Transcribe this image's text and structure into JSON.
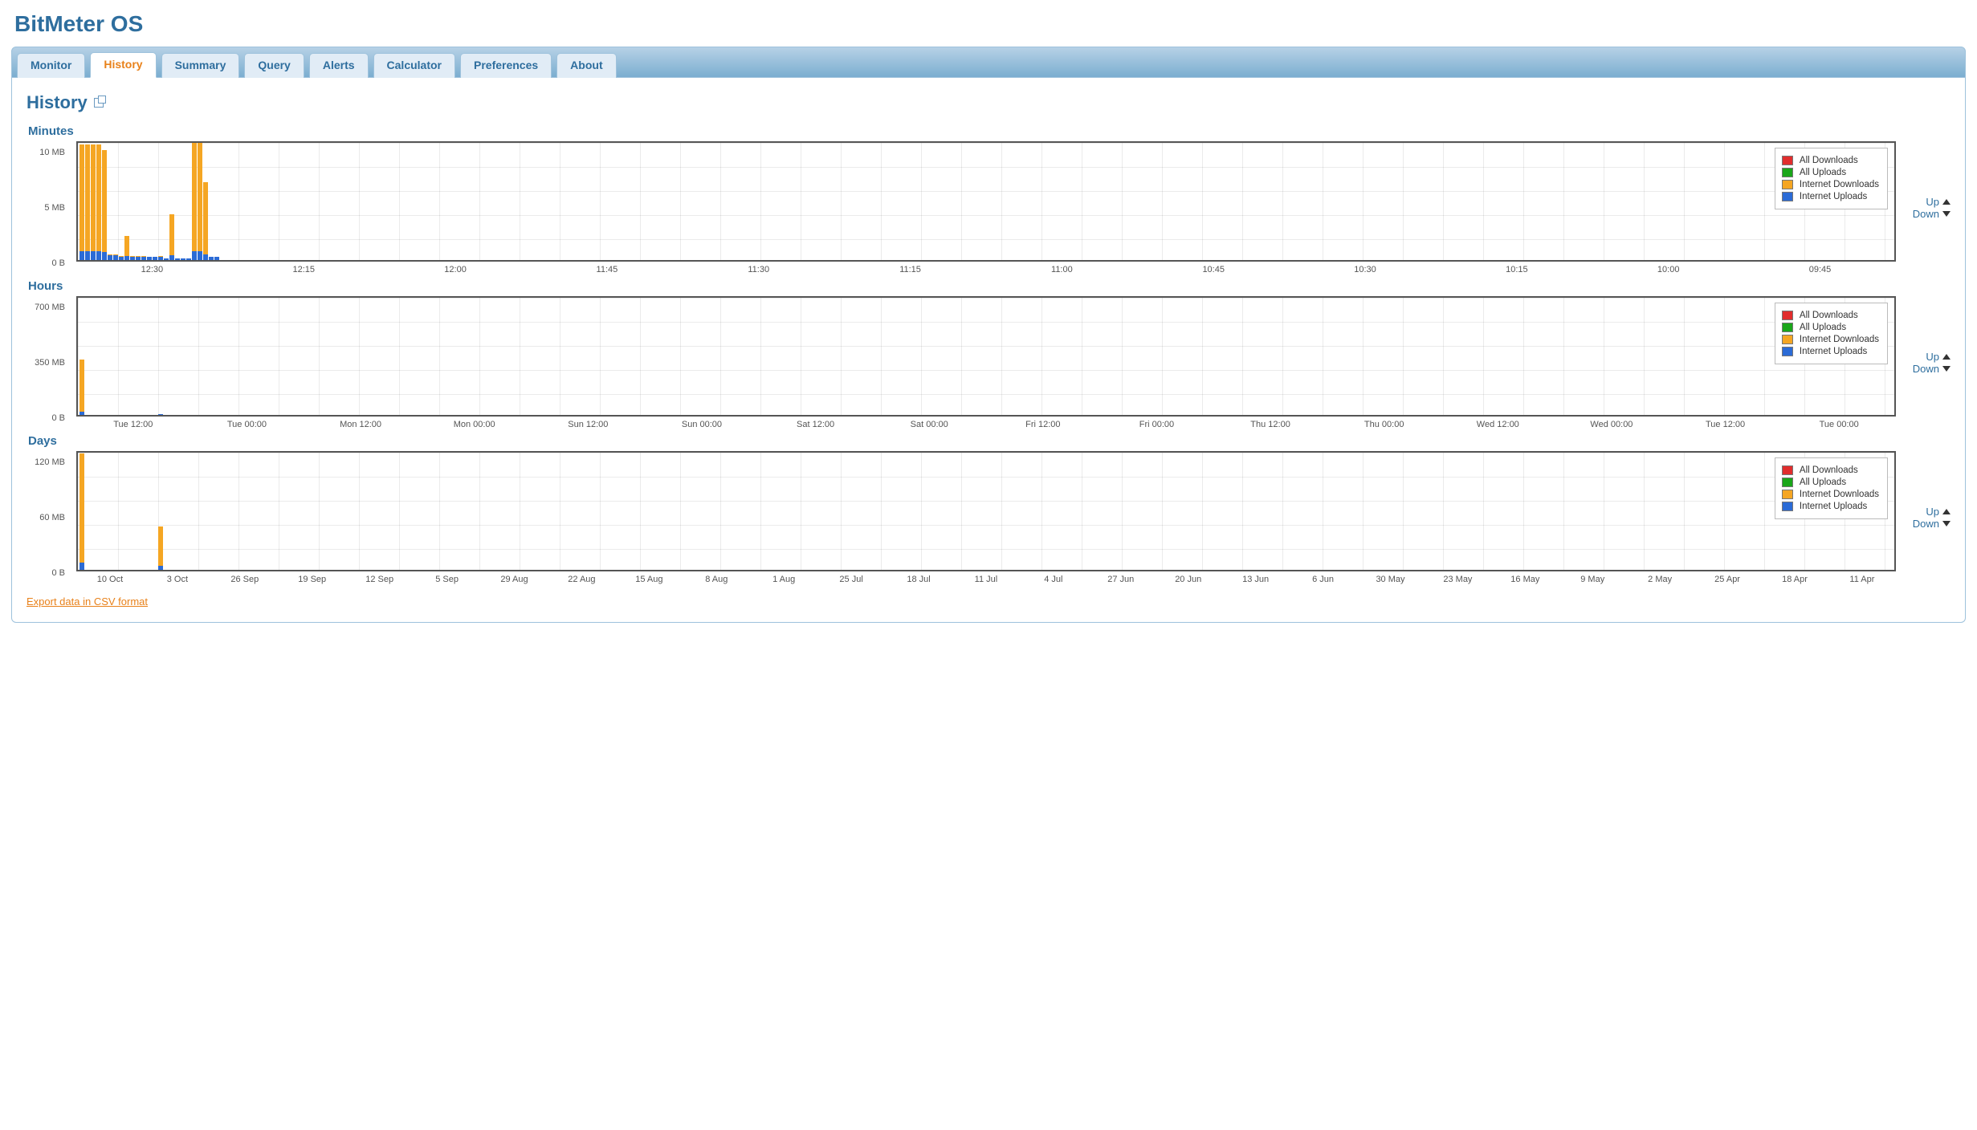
{
  "app_title": "BitMeter OS",
  "tabs": [
    {
      "id": "monitor",
      "label": "Monitor"
    },
    {
      "id": "history",
      "label": "History"
    },
    {
      "id": "summary",
      "label": "Summary"
    },
    {
      "id": "query",
      "label": "Query"
    },
    {
      "id": "alerts",
      "label": "Alerts"
    },
    {
      "id": "calculator",
      "label": "Calculator"
    },
    {
      "id": "preferences",
      "label": "Preferences"
    },
    {
      "id": "about",
      "label": "About"
    }
  ],
  "active_tab": "history",
  "page_title": "History",
  "nav": {
    "up": "Up",
    "down": "Down"
  },
  "legend": [
    {
      "label": "All Downloads",
      "color": "#e12d2d"
    },
    {
      "label": "All Uploads",
      "color": "#1aa61a"
    },
    {
      "label": "Internet Downloads",
      "color": "#f5a623"
    },
    {
      "label": "Internet Uploads",
      "color": "#2b6bd6"
    }
  ],
  "export_label": "Export data in CSV format",
  "sections": {
    "minutes": {
      "title": "Minutes"
    },
    "hours": {
      "title": "Hours"
    },
    "days": {
      "title": "Days"
    }
  },
  "chart_data": [
    {
      "id": "minutes",
      "type": "bar",
      "title": "Minutes",
      "ylabel": "",
      "y_ticks": [
        "10 MB",
        "5 MB",
        "0 B"
      ],
      "ylim_mb": [
        0,
        12
      ],
      "x_ticks": [
        "12:30",
        "12:15",
        "12:00",
        "11:45",
        "11:30",
        "11:15",
        "11:00",
        "10:45",
        "10:30",
        "10:15",
        "10:00",
        "09:45"
      ],
      "series": [
        {
          "name": "Internet Downloads",
          "unit": "MB",
          "values": [
            11.5,
            11.5,
            11.5,
            11.5,
            11.0,
            0.6,
            0.6,
            0.4,
            2.4,
            0.4,
            0.4,
            0.4,
            0.3,
            0.3,
            0.4,
            0.2,
            4.6,
            0.2,
            0.2,
            0.2,
            11.8,
            11.8,
            7.8,
            0.3,
            0.3
          ]
        },
        {
          "name": "Internet Uploads",
          "unit": "MB",
          "values": [
            0.9,
            0.9,
            0.9,
            0.9,
            0.8,
            0.5,
            0.5,
            0.3,
            0.4,
            0.3,
            0.3,
            0.3,
            0.3,
            0.3,
            0.3,
            0.2,
            0.5,
            0.2,
            0.2,
            0.2,
            0.9,
            0.9,
            0.6,
            0.3,
            0.3
          ]
        },
        {
          "name": "All Downloads",
          "unit": "MB",
          "values": [
            0,
            0,
            0,
            0,
            0,
            0,
            0,
            0,
            0,
            0,
            0,
            0,
            0,
            0,
            0,
            0,
            0,
            0,
            0,
            0,
            0,
            0,
            0,
            0,
            0
          ]
        },
        {
          "name": "All Uploads",
          "unit": "MB",
          "values": [
            0,
            0,
            0,
            0,
            0,
            0,
            0,
            0,
            0,
            0,
            0,
            0,
            0,
            0,
            0,
            0,
            0,
            0,
            0,
            0,
            0,
            0,
            0,
            0,
            0
          ]
        }
      ]
    },
    {
      "id": "hours",
      "type": "bar",
      "title": "Hours",
      "ylabel": "",
      "y_ticks": [
        "700 MB",
        "350 MB",
        "0 B"
      ],
      "ylim_mb": [
        0,
        700
      ],
      "x_ticks": [
        "Tue 12:00",
        "Tue 00:00",
        "Mon 12:00",
        "Mon 00:00",
        "Sun 12:00",
        "Sun 00:00",
        "Sat 12:00",
        "Sat 00:00",
        "Fri 12:00",
        "Fri 00:00",
        "Thu 12:00",
        "Thu 00:00",
        "Wed 12:00",
        "Wed 00:00",
        "Tue 12:00",
        "Tue 00:00"
      ],
      "series": [
        {
          "name": "Internet Downloads",
          "unit": "MB",
          "values": [
            320,
            0,
            0,
            0,
            0,
            0,
            0,
            0,
            0,
            0,
            0,
            0,
            0,
            0,
            6,
            0,
            0,
            0,
            0,
            0,
            0,
            0,
            0,
            0,
            0,
            0,
            0,
            0,
            0,
            0,
            0,
            0,
            0,
            0
          ]
        },
        {
          "name": "Internet Uploads",
          "unit": "MB",
          "values": [
            18,
            0,
            0,
            0,
            0,
            0,
            0,
            0,
            0,
            0,
            0,
            0,
            0,
            0,
            3,
            0,
            0,
            0,
            0,
            0,
            0,
            0,
            0,
            0,
            0,
            0,
            0,
            0,
            0,
            0,
            0,
            0,
            0,
            0
          ]
        },
        {
          "name": "All Downloads",
          "unit": "MB",
          "values": [
            0,
            0,
            0,
            0,
            0,
            0,
            0,
            0,
            0,
            0,
            0,
            0,
            0,
            0,
            0,
            0,
            0,
            0,
            0,
            0,
            0,
            0,
            0,
            0,
            0,
            0,
            0,
            0,
            0,
            0,
            0,
            0,
            0,
            0
          ]
        },
        {
          "name": "All Uploads",
          "unit": "MB",
          "values": [
            0,
            0,
            0,
            0,
            0,
            0,
            0,
            0,
            0,
            0,
            0,
            0,
            0,
            0,
            0,
            0,
            0,
            0,
            0,
            0,
            0,
            0,
            0,
            0,
            0,
            0,
            0,
            0,
            0,
            0,
            0,
            0,
            0,
            0
          ]
        }
      ]
    },
    {
      "id": "days",
      "type": "bar",
      "title": "Days",
      "ylabel": "",
      "y_ticks": [
        "120 MB",
        "60 MB",
        "0 B"
      ],
      "ylim_mb": [
        0,
        160
      ],
      "x_ticks": [
        "10 Oct",
        "3 Oct",
        "26 Sep",
        "19 Sep",
        "12 Sep",
        "5 Sep",
        "29 Aug",
        "22 Aug",
        "15 Aug",
        "8 Aug",
        "1 Aug",
        "25 Jul",
        "18 Jul",
        "11 Jul",
        "4 Jul",
        "27 Jun",
        "20 Jun",
        "13 Jun",
        "6 Jun",
        "30 May",
        "23 May",
        "16 May",
        "9 May",
        "2 May",
        "25 Apr",
        "18 Apr",
        "11 Apr"
      ],
      "series": [
        {
          "name": "Internet Downloads",
          "unit": "MB",
          "values": [
            155,
            0,
            0,
            0,
            0,
            0,
            0,
            0,
            0,
            0,
            0,
            0,
            0,
            0,
            58,
            0,
            0,
            0,
            0,
            0,
            0,
            0,
            0,
            0,
            0,
            0,
            0,
            0,
            0,
            0,
            0,
            0,
            0,
            0,
            0,
            0,
            0,
            0,
            0,
            0
          ]
        },
        {
          "name": "Internet Uploads",
          "unit": "MB",
          "values": [
            10,
            0,
            0,
            0,
            0,
            0,
            0,
            0,
            0,
            0,
            0,
            0,
            0,
            0,
            5,
            0,
            0,
            0,
            0,
            0,
            0,
            0,
            0,
            0,
            0,
            0,
            0,
            0,
            0,
            0,
            0,
            0,
            0,
            0,
            0,
            0,
            0,
            0,
            0,
            0
          ]
        },
        {
          "name": "All Downloads",
          "unit": "MB",
          "values": [
            0,
            0,
            0,
            0,
            0,
            0,
            0,
            0,
            0,
            0,
            0,
            0,
            0,
            0,
            0,
            0,
            0,
            0,
            0,
            0,
            0,
            0,
            0,
            0,
            0,
            0,
            0,
            0,
            0,
            0,
            0,
            0,
            0,
            0,
            0,
            0,
            0,
            0,
            0,
            0
          ]
        },
        {
          "name": "All Uploads",
          "unit": "MB",
          "values": [
            0,
            0,
            0,
            0,
            0,
            0,
            0,
            0,
            0,
            0,
            0,
            0,
            0,
            0,
            0,
            0,
            0,
            0,
            0,
            0,
            0,
            0,
            0,
            0,
            0,
            0,
            0,
            0,
            0,
            0,
            0,
            0,
            0,
            0,
            0,
            0,
            0,
            0,
            0,
            0
          ]
        }
      ]
    }
  ]
}
